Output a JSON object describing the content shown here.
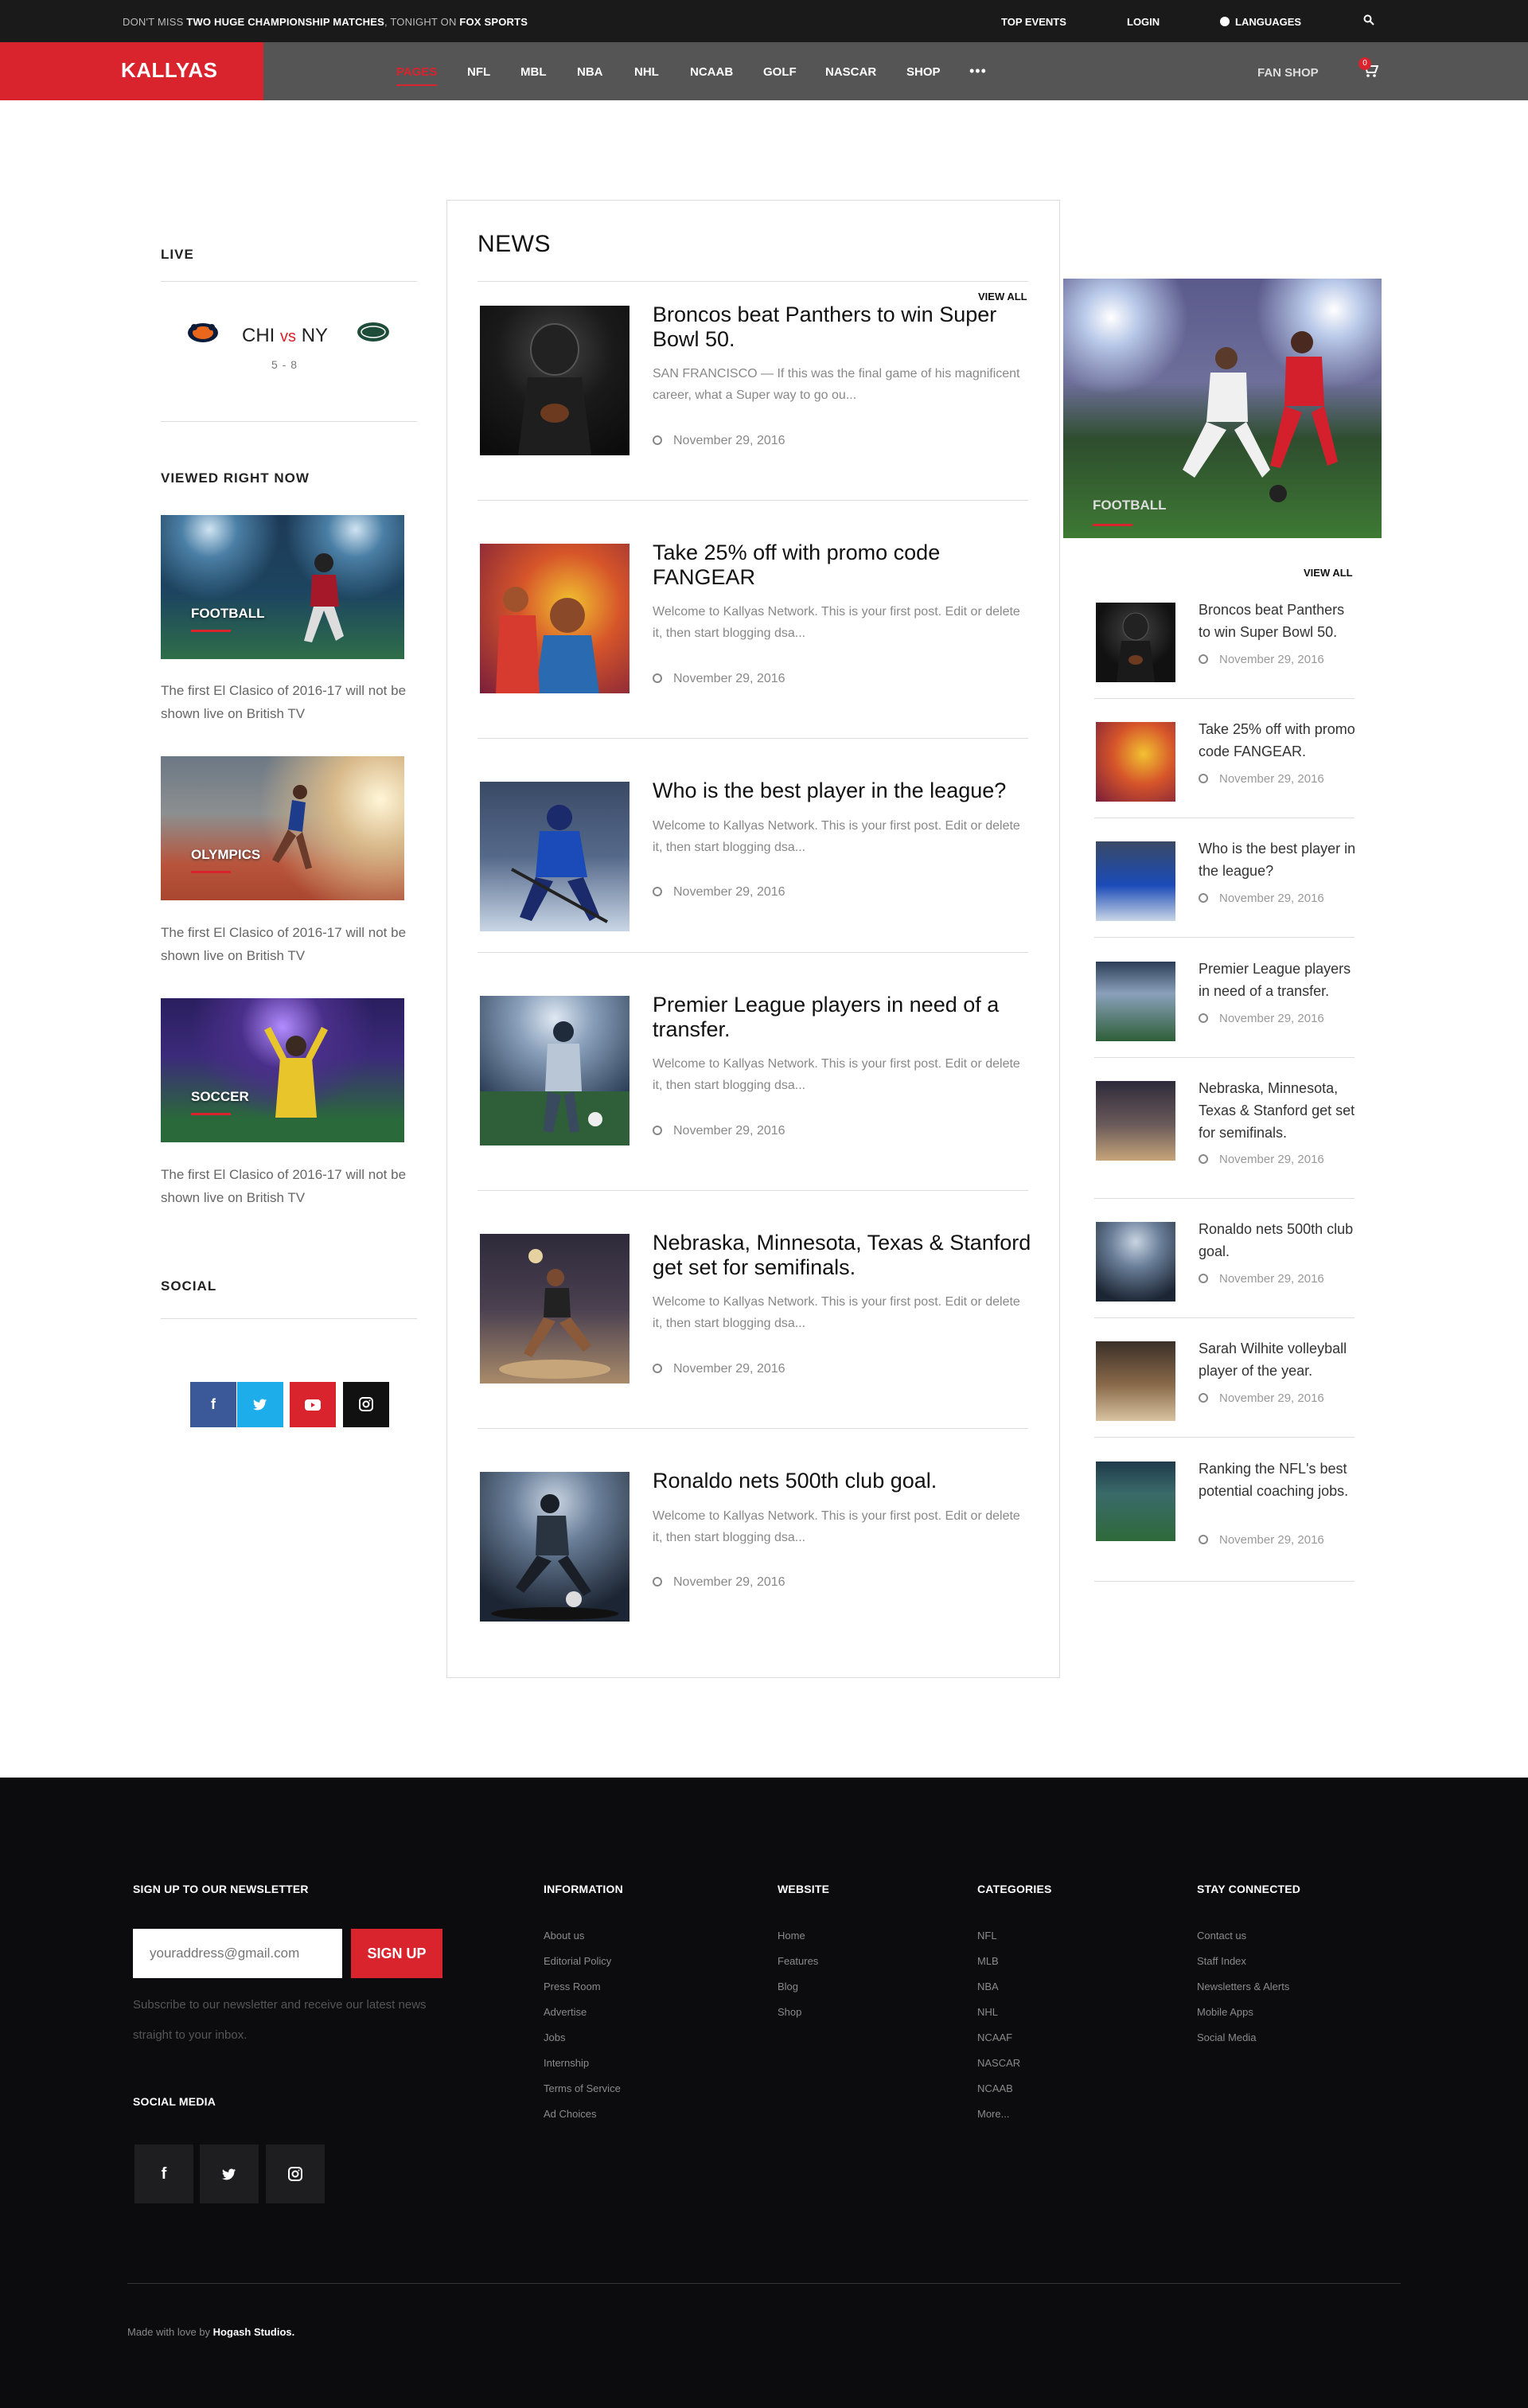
{
  "topbar": {
    "promo_prefix": "DON'T MISS ",
    "promo_bold": "TWO HUGE CHAMPIONSHIP MATCHES",
    "promo_mid": ", TONIGHT ON ",
    "promo_channel": "FOX SPORTS",
    "top_events": "TOP EVENTS",
    "login": "LOGIN",
    "languages": "LANGUAGES"
  },
  "nav": {
    "logo": "KALLYAS",
    "items": [
      "PAGES",
      "NFL",
      "MBL",
      "NBA",
      "NHL",
      "NCAAB",
      "GOLF",
      "NASCAR",
      "SHOP"
    ],
    "more": "•••",
    "fan_shop": "FAN SHOP",
    "cart_count": "0"
  },
  "live": {
    "title": "LIVE",
    "home": "CHI",
    "vs": "vs",
    "away": "NY",
    "score": "5 - 8"
  },
  "viewed": {
    "title": "VIEWED RIGHT NOW",
    "items": [
      {
        "label": "FOOTBALL",
        "caption": "The first El Clasico of 2016-17 will not be shown live on British TV"
      },
      {
        "label": "OLYMPICS",
        "caption": "The first El Clasico of 2016-17 will not be shown live on British TV"
      },
      {
        "label": "SOCCER",
        "caption": "The first El Clasico of 2016-17 will not be shown live on British TV"
      }
    ]
  },
  "social": {
    "title": "SOCIAL",
    "colors": {
      "facebook": "#3b5998",
      "twitter": "#1dadea",
      "youtube": "#d9232d",
      "instagram": "#111111"
    }
  },
  "news": {
    "title": "NEWS",
    "view_all": "VIEW ALL",
    "articles": [
      {
        "title": "Broncos beat Panthers to win Super Bowl 50.",
        "excerpt": "SAN FRANCISCO — If this was the final game of his magnificent career, what a Super way to go ou...",
        "date": "November 29, 2016"
      },
      {
        "title": "Take 25% off with promo code FANGEAR",
        "excerpt": "Welcome to Kallyas Network. This is your first post. Edit or delete it, then start blogging dsa...",
        "date": "November 29, 2016"
      },
      {
        "title": "Who is the best player in the league?",
        "excerpt": "Welcome to Kallyas Network. This is your first post. Edit or delete it, then start blogging dsa...",
        "date": "November 29, 2016"
      },
      {
        "title": "Premier League players in need of a transfer.",
        "excerpt": "Welcome to Kallyas Network. This is your first post. Edit or delete it, then start blogging dsa...",
        "date": "November 29, 2016"
      },
      {
        "title": "Nebraska, Minnesota, Texas & Stanford get set for semifinals.",
        "excerpt": "Welcome to Kallyas Network. This is your first post. Edit or delete it, then start blogging dsa...",
        "date": "November 29, 2016"
      },
      {
        "title": "Ronaldo nets 500th club goal.",
        "excerpt": "Welcome to Kallyas Network. This is your first post. Edit or delete it, then start blogging dsa...",
        "date": "November 29, 2016"
      }
    ]
  },
  "sidebar": {
    "feature_label": "FOOTBALL",
    "view_all": "VIEW ALL",
    "items": [
      {
        "title": "Broncos beat Panthers to win Super Bowl 50.",
        "date": "November 29, 2016"
      },
      {
        "title": "Take 25% off with promo code FANGEAR.",
        "date": "November 29, 2016"
      },
      {
        "title": "Who is the best player in the league?",
        "date": "November 29, 2016"
      },
      {
        "title": "Premier League players in need of a transfer.",
        "date": "November 29, 2016"
      },
      {
        "title": "Nebraska, Minnesota, Texas & Stanford get set for semifinals.",
        "date": "November 29, 2016"
      },
      {
        "title": "Ronaldo nets 500th club goal.",
        "date": "November 29, 2016"
      },
      {
        "title": "Sarah Wilhite volleyball player of the year.",
        "date": "November 29, 2016"
      },
      {
        "title": "Ranking the NFL's best potential coaching jobs.",
        "date": "November 29, 2016"
      }
    ]
  },
  "footer": {
    "newsletter_title": "SIGN UP TO OUR NEWSLETTER",
    "email_placeholder": "youraddress@gmail.com",
    "signup": "SIGN UP",
    "note": "Subscribe to our newsletter and receive our latest news straight to your inbox.",
    "social_title": "SOCIAL MEDIA",
    "information": {
      "title": "INFORMATION",
      "links": [
        "About us",
        "Editorial Policy",
        "Press Room",
        "Advertise",
        "Jobs",
        "Internship",
        "Terms of Service",
        "Ad Choices"
      ]
    },
    "website": {
      "title": "WEBSITE",
      "links": [
        "Home",
        "Features",
        "Blog",
        "Shop"
      ]
    },
    "categories": {
      "title": "CATEGORIES",
      "links": [
        "NFL",
        "MLB",
        "NBA",
        "NHL",
        "NCAAF",
        "NASCAR",
        "NCAAB",
        "More..."
      ]
    },
    "connected": {
      "title": "STAY CONNECTED",
      "links": [
        "Contact us",
        "Staff Index",
        "Newsletters & Alerts",
        "Mobile Apps",
        "Social Media"
      ]
    },
    "credit_prefix": "Made with love by ",
    "credit_name": "Hogash Studios."
  },
  "accent_color": "#d9232d"
}
